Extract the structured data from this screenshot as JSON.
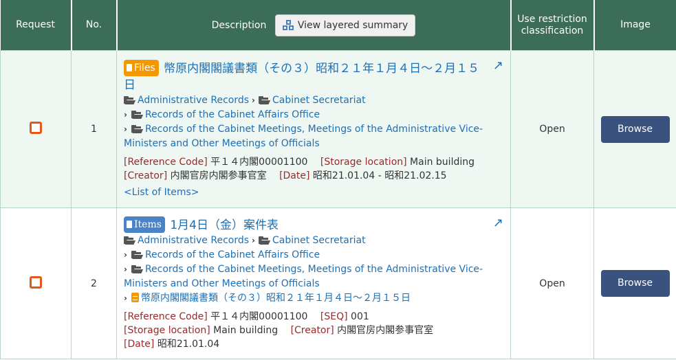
{
  "header": {
    "request": "Request",
    "no": "No.",
    "description": "Description",
    "layered_summary_button": "View layered summary",
    "use_restriction": "Use restriction classification",
    "image": "Image"
  },
  "rows": [
    {
      "no": "1",
      "badge": "Files",
      "title": "幣原内閣閣議書類（その３）昭和２１年１月４日～２月１５日",
      "breadcrumbs": {
        "level1": "Administrative Records",
        "level2": "Cabinet Secretariat",
        "level3": "Records of the Cabinet Affairs Office",
        "level4": "Records of the Cabinet Meetings, Meetings of the Administrative Vice-Ministers and Other Meetings of Officials"
      },
      "meta": {
        "ref_label": "[Reference Code]",
        "ref_value": "平１４内閣00001100",
        "storage_label": "[Storage location]",
        "storage_value": "Main building",
        "creator_label": "[Creator]",
        "creator_value": "内閣官房内閣参事官室",
        "date_label": "[Date]",
        "date_value": "昭和21.01.04 - 昭和21.02.15"
      },
      "list_link": "<List of Items>",
      "restriction": "Open",
      "browse": "Browse"
    },
    {
      "no": "2",
      "badge": "Items",
      "title": "1月4日（金）案件表",
      "breadcrumbs": {
        "level1": "Administrative Records",
        "level2": "Cabinet Secretariat",
        "level3": "Records of the Cabinet Affairs Office",
        "level4": "Records of the Cabinet Meetings, Meetings of the Administrative Vice-Ministers and Other Meetings of Officials",
        "level5": "幣原内閣閣議書類（その３）昭和２１年１月４日～２月１５日"
      },
      "meta": {
        "ref_label": "[Reference Code]",
        "ref_value": "平１４内閣00001100",
        "seq_label": "[SEQ]",
        "seq_value": "001",
        "storage_label": "[Storage location]",
        "storage_value": "Main building",
        "creator_label": "[Creator]",
        "creator_value": "内閣官房内閣参事官室",
        "date_label": "[Date]",
        "date_value": "昭和21.01.04"
      },
      "restriction": "Open",
      "browse": "Browse"
    }
  ],
  "colors": {
    "header_bg": "#3c6d58",
    "row_alt_bg": "#eef7f2",
    "link": "#1f6fb3",
    "files_badge": "#f39800",
    "items_badge": "#4a84c6",
    "checkbox": "#e8561a",
    "browse_button": "#3a527e",
    "meta_label": "#9a2a2a"
  }
}
